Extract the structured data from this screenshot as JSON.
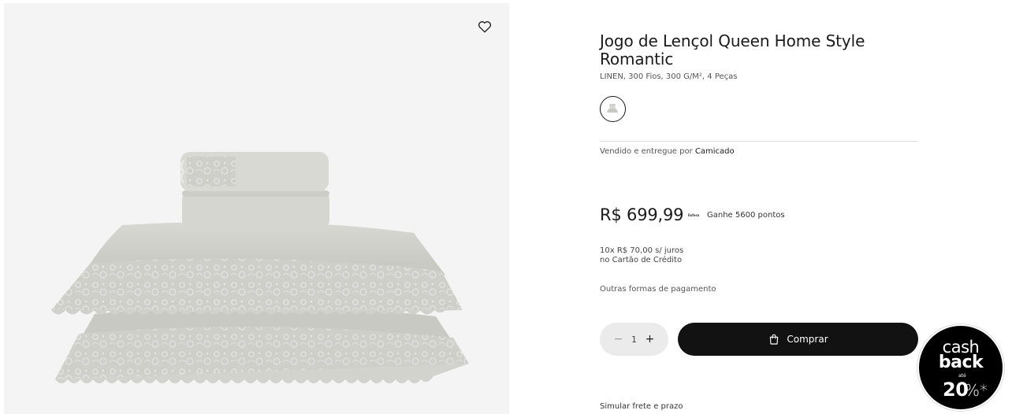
{
  "product": {
    "title": "Jogo de Lençol Queen Home Style Romantic",
    "subtitle": "LINEN, 300 Fios, 300 G/M², 4 Peças",
    "favorite_icon": "heart-icon",
    "swatch_icon": "linen-swatch-icon",
    "image_alt": "Jogo de Lençol Queen Home Style Romantic"
  },
  "seller": {
    "label": "Vendido e entregue por",
    "name": "Camicado"
  },
  "pricing": {
    "price": "R$ 699,99",
    "points_logo": "Esfera",
    "points_text": "Ganhe 5600 pontos",
    "installments_line1": "10x R$ 70,00 s/ juros",
    "installments_line2": "no Cartão de Crédito",
    "other_payments": "Outras formas de pagamento"
  },
  "purchase": {
    "qty_minus": "−",
    "qty_value": "1",
    "qty_plus": "+",
    "buy_label": "Comprar",
    "buy_icon": "shopping-bag-icon"
  },
  "shipping": {
    "label": "Simular frete e prazo"
  },
  "cashback": {
    "line1": "cash",
    "line2": "back",
    "upto": "até",
    "percent": "20",
    "percent_sign": "%*"
  },
  "colors": {
    "buy_button": "#121212",
    "qty_background": "#ebebeb",
    "gallery_background": "#f4f4f4"
  }
}
